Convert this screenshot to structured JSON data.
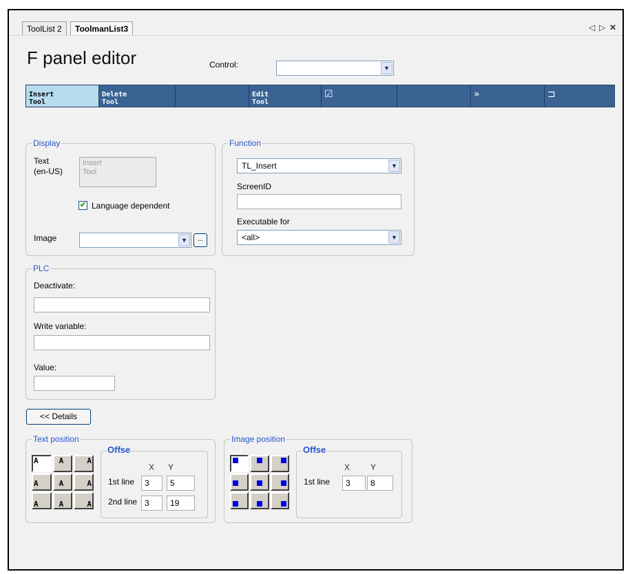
{
  "tabs": [
    {
      "label": "ToolList 2",
      "active": false
    },
    {
      "label": "ToolmanList3",
      "active": true
    }
  ],
  "window_controls": {
    "prev": "◁",
    "next": "▷",
    "close": "✕"
  },
  "header": {
    "title": "F panel editor",
    "control_label": "Control:",
    "control_value": ""
  },
  "toolbar": {
    "buttons": [
      {
        "line1": "Insert",
        "line2": "Tool",
        "selected": true
      },
      {
        "line1": "Delete",
        "line2": "Tool",
        "selected": false
      },
      {
        "line1": "",
        "line2": "",
        "selected": false
      },
      {
        "line1": "Edit",
        "line2": "Tool",
        "selected": false
      },
      {
        "icon": "☑",
        "icon_name": "checkbox-icon"
      },
      {
        "line1": "",
        "line2": "",
        "selected": false
      },
      {
        "icon": "»",
        "icon_name": "double-chevron-right-icon"
      },
      {
        "icon": "⊐",
        "icon_name": "return-arrow-icon"
      }
    ]
  },
  "display": {
    "legend": "Display",
    "text_label_1": "Text",
    "text_label_2": "(en-US)",
    "text_value_1": "Insert",
    "text_value_2": "Tool",
    "language_dependent_label": "Language dependent",
    "language_dependent_checked": true,
    "image_label": "Image",
    "image_value": "",
    "browse_label": "..."
  },
  "function": {
    "legend": "Function",
    "function_value": "TL_Insert",
    "screenid_label": "ScreenID",
    "screenid_value": "",
    "executable_label": "Executable for",
    "executable_value": "<all>"
  },
  "plc": {
    "legend": "PLC",
    "deactivate_label": "Deactivate:",
    "deactivate_value": "",
    "write_variable_label": "Write variable:",
    "write_variable_value": "",
    "value_label": "Value:",
    "value_value": ""
  },
  "details_button": "<< Details",
  "text_position": {
    "legend": "Text position",
    "grid_glyph": "A",
    "offset_legend": "Offset",
    "x_label": "X",
    "y_label": "Y",
    "line1_label": "1st line",
    "line1_x": "3",
    "line1_y": "5",
    "line2_label": "2nd line",
    "line2_x": "3",
    "line2_y": "19"
  },
  "image_position": {
    "legend": "Image position",
    "offset_legend": "Offset",
    "x_label": "X",
    "y_label": "Y",
    "line1_label": "1st line",
    "line1_x": "3",
    "line1_y": "8"
  },
  "colors": {
    "toolbar_bg": "#3a6394",
    "toolbar_selected": "#b7dced",
    "legend_text": "#2a55c8",
    "marker_blue": "#0000e0"
  }
}
